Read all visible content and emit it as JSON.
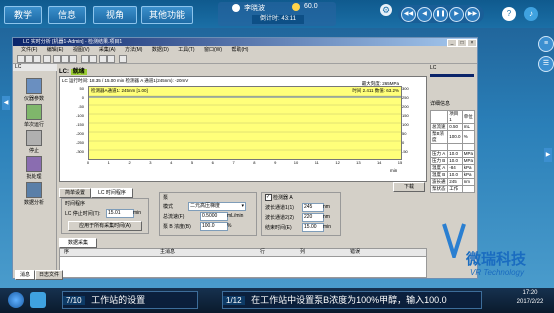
{
  "top_nav": {
    "tabs": [
      "教学",
      "信息",
      "视角",
      "其他功能"
    ],
    "user_name": "李晓波",
    "score": "60.0",
    "countdown": "倒计时: 43:11"
  },
  "window": {
    "title": "LC 实时分析 [机器1-Admin] - 检测结果.项目1",
    "menu": [
      "文件(F)",
      "编辑(E)",
      "视图(V)",
      "采集(A)",
      "方法(M)",
      "数据(D)",
      "工具(T)",
      "窗口(W)",
      "帮助(H)"
    ],
    "left_items": [
      "LC",
      "仪器参数",
      "单次运行",
      "停止",
      "批处理",
      "数据分析"
    ],
    "lc_label": "LC:",
    "lc_status": "就绪",
    "run_info": "LC 运行时间: 18.35 / 15.00 min  检测器 A 通道1(245nm): -20mV",
    "chart": {
      "info_left": "检测器A通道1: 245nm  [1.00]",
      "info_right_1": "最大刻度: 265MPa",
      "info_right_2": "时间 2.411  数值: 63.2%",
      "y_ticks": [
        "50",
        "0",
        "-50",
        "-100",
        "-150",
        "-200",
        "-250",
        "-300"
      ],
      "x_ticks": [
        "0",
        "1",
        "2",
        "3",
        "4",
        "5",
        "6",
        "7",
        "8",
        "9",
        "10",
        "11",
        "12",
        "13",
        "14",
        "15"
      ],
      "x_unit": "min",
      "right_ticks": [
        "300",
        "250",
        "200",
        "150",
        "100",
        "50",
        "0",
        "-50"
      ]
    },
    "btn_next": "下载",
    "tabs_bottom": [
      "简单设置",
      "LC 时间程序"
    ],
    "time_program": {
      "label": "时间程序",
      "stop_time_label": "LC 停止时间(T):",
      "stop_time_value": "15.01",
      "stop_time_unit": "min",
      "apply_btn": "应用于所有采集时间(A)"
    },
    "pump": {
      "label": "泵",
      "mode_label": "模式",
      "mode_value": "二元高压梯度",
      "flow_label": "总流速(F)",
      "flow_value": "0.5000",
      "flow_unit": "mL/min",
      "conc_label": "泵 B 浓度(B)",
      "conc_value": "100.0",
      "conc_unit": "%"
    },
    "detector": {
      "label": "检测器 A",
      "wl1_label": "波长通道1(1)",
      "wl1_value": "245",
      "wl1_unit": "nm",
      "wl2_label": "波长通道2(2)",
      "wl2_value": "220",
      "wl2_unit": "nm",
      "end_label": "结束时间(E)",
      "end_value": "15.00",
      "end_unit": "min"
    },
    "acq_tab": "数据采集",
    "output_cols": [
      "序",
      "主消息",
      "行",
      "列",
      "错误"
    ],
    "output_tabs": [
      "消息",
      "日志文件"
    ],
    "right_header": "LC",
    "right_section": "详细信息",
    "prop_head": [
      "项目1",
      "单位"
    ],
    "props": [
      [
        "总流速",
        "0.50",
        "mL"
      ],
      [
        "泵B浓度",
        "100.0",
        "%"
      ],
      [
        "",
        "",
        ""
      ],
      [
        "压力 A",
        "10.0",
        "MPa"
      ],
      [
        "压力 B",
        "10.0",
        "MPa"
      ],
      [
        "温度 A",
        "-84",
        "kPa"
      ],
      [
        "温度 B",
        "10.0",
        "kPa"
      ],
      [
        "波长通",
        "245",
        "nm"
      ],
      [
        "泵状态",
        "工作",
        ""
      ]
    ]
  },
  "brand": {
    "title": "微瑞科技",
    "subtitle": "VR Technology"
  },
  "bottom_tasks": [
    {
      "num": "7/10",
      "text": "工作站的设置"
    },
    {
      "num": "1/12",
      "text": "在工作站中设置泵B浓度为100%甲醇，输入100.0"
    }
  ],
  "clock": {
    "time": "17:20",
    "date": "2017/2/22"
  },
  "colors": {
    "accent": "#1b6fa6",
    "plot_bg": "#ffff7a",
    "status_green": "#9acd32"
  }
}
